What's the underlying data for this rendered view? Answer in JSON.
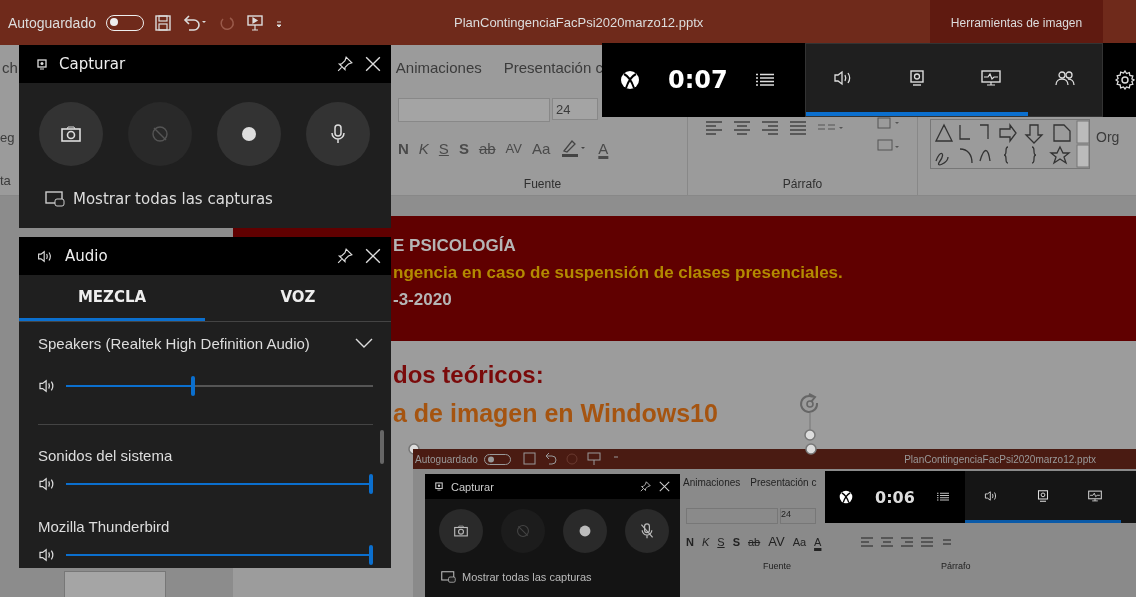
{
  "title_bar": {
    "autosave_label": "Autoguardado",
    "autosave_on": false,
    "filename": "PlanContingenciaFacPsi2020marzo12.pptx",
    "context_tab": "Herramientas de imagen"
  },
  "ribbon": {
    "tabs": [
      "ch",
      "Animaciones",
      "Presentación c"
    ],
    "font_size": "24",
    "format_buttons": [
      "N",
      "K",
      "S",
      "S",
      "ab",
      "AV",
      "Aa"
    ],
    "font_color_label": "A",
    "groups": [
      "Fuente",
      "Párrafo"
    ],
    "left_labels": [
      "eg",
      "ta"
    ],
    "right_label": "Org"
  },
  "slide": {
    "header": [
      "E PSICOLOGÍA",
      "ngencia en caso de suspensión de clases presenciales.",
      "-3-2020"
    ],
    "heading": "dos teóricos:",
    "subheading": "a de imagen en Windows10"
  },
  "game_bar": {
    "timer": "0:07",
    "widgets": [
      {
        "kind": "audio",
        "active": true
      },
      {
        "kind": "capture",
        "active": true
      },
      {
        "kind": "performance",
        "active": true
      },
      {
        "kind": "social",
        "active": false
      }
    ]
  },
  "capture": {
    "title": "Capturar",
    "buttons": [
      {
        "kind": "screenshot",
        "disabled": false
      },
      {
        "kind": "replay",
        "disabled": true
      },
      {
        "kind": "record",
        "disabled": false
      },
      {
        "kind": "mic",
        "disabled": false,
        "muted": false
      }
    ],
    "gallery_link": "Mostrar todas las capturas"
  },
  "audio": {
    "title": "Audio",
    "tabs": [
      {
        "label": "MEZCLA",
        "selected": true
      },
      {
        "label": "VOZ",
        "selected": false
      }
    ],
    "device": {
      "name": "Speakers (Realtek High Definition Audio)",
      "level": 0.42
    },
    "apps": [
      {
        "name": "Sonidos del sistema",
        "level": 1
      },
      {
        "name": "Mozilla Thunderbird",
        "level": 1
      }
    ]
  },
  "nested_screenshot": {
    "autosave_label": "Autoguardado",
    "filename": "PlanContingenciaFacPsi2020marzo12.pptx",
    "ribbon_tabs": [
      "Animaciones",
      "Presentación c"
    ],
    "font_size": "24",
    "format_buttons": [
      "N",
      "K",
      "S",
      "S",
      "ab",
      "AV",
      "Aa"
    ],
    "font_color_label": "A",
    "groups": [
      "Fuente",
      "Párrafo"
    ],
    "timer": "0:06",
    "widgets": [
      {
        "kind": "audio",
        "active": true
      },
      {
        "kind": "capture",
        "active": true
      },
      {
        "kind": "performance",
        "active": true
      }
    ],
    "capture_title": "Capturar",
    "capture_buttons": [
      {
        "kind": "screenshot",
        "disabled": false
      },
      {
        "kind": "replay",
        "disabled": true
      },
      {
        "kind": "record",
        "disabled": false
      },
      {
        "kind": "mic",
        "disabled": false,
        "muted": true
      }
    ],
    "gallery_link": "Mostrar todas las capturas"
  }
}
